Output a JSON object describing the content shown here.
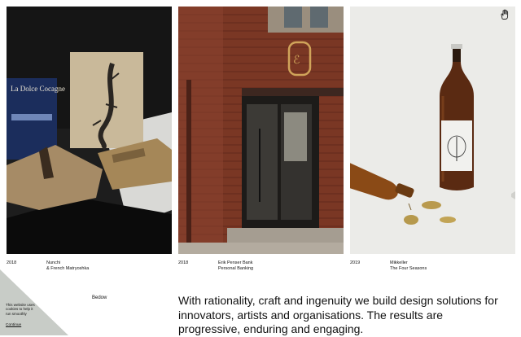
{
  "projects": [
    {
      "year": "2018",
      "client": "Nunchi",
      "subtitle": "& French Matryoshka"
    },
    {
      "year": "2018",
      "client": "Erik Penser Bank",
      "subtitle": "Personal Banking"
    },
    {
      "year": "2019",
      "client": "Mikkeller",
      "subtitle": "The Four Seasons"
    }
  ],
  "book_cover_text": "La Dolce Cocagne",
  "studio_name": "Bedow",
  "tagline": "With rationality, craft and ingenuity we build design solutions for innovators, artists and organisations. The results are progressive, enduring and engaging.",
  "cookie": {
    "message": "This website uses cookies to help it run smoothly",
    "action": "Continue"
  },
  "icons": {
    "corner": "hand-icon"
  }
}
